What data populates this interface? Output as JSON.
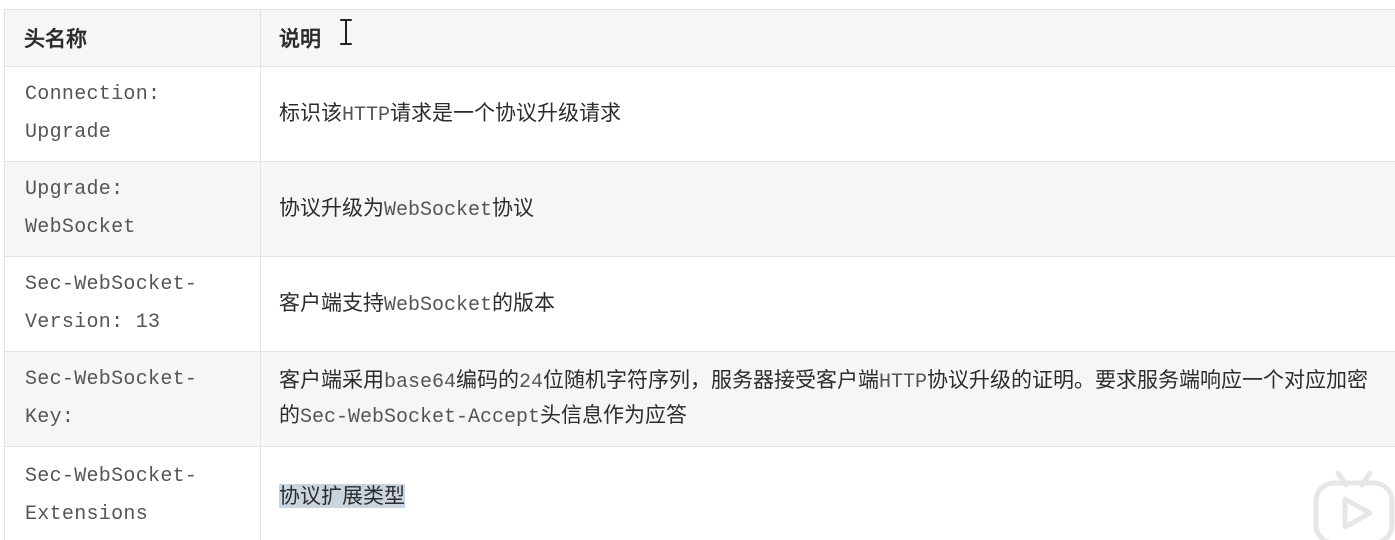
{
  "table": {
    "headers": {
      "name": "头名称",
      "description": "说明"
    },
    "rows": [
      {
        "name_line1": "Connection:",
        "name_line2": "Upgrade",
        "desc_parts": [
          "标识该",
          "HTTP",
          "请求是一个协议升级请求"
        ]
      },
      {
        "name_line1": "Upgrade:",
        "name_line2": "WebSocket",
        "desc_parts": [
          "协议升级为",
          "WebSocket",
          "协议"
        ]
      },
      {
        "name_line1": "Sec-WebSocket-",
        "name_line2": "Version: 13",
        "desc_parts": [
          "客户端支持",
          "WebSocket",
          "的版本"
        ]
      },
      {
        "name_line1": "Sec-WebSocket-",
        "name_line2": "Key:",
        "desc_parts": [
          "客户端采用",
          "base64",
          "编码的",
          "24",
          "位随机字符序列，服务器接受客户端",
          "HTTP",
          "协议升级的证明。要求服务端响应一个对应加密的",
          "Sec-WebSocket-Accept",
          "头信息作为应答"
        ]
      },
      {
        "name_line1": "Sec-WebSocket-",
        "name_line2": "Extensions",
        "desc_parts": [
          "协议扩展类型"
        ]
      }
    ]
  },
  "overlay": {
    "cursor": "text-cursor-icon",
    "player_badge": "video-play-icon"
  },
  "colors": {
    "header_bg": "#f6f6f6",
    "border": "#e4e4e4",
    "mono_text": "#555555",
    "highlight": "#c9d4df"
  }
}
